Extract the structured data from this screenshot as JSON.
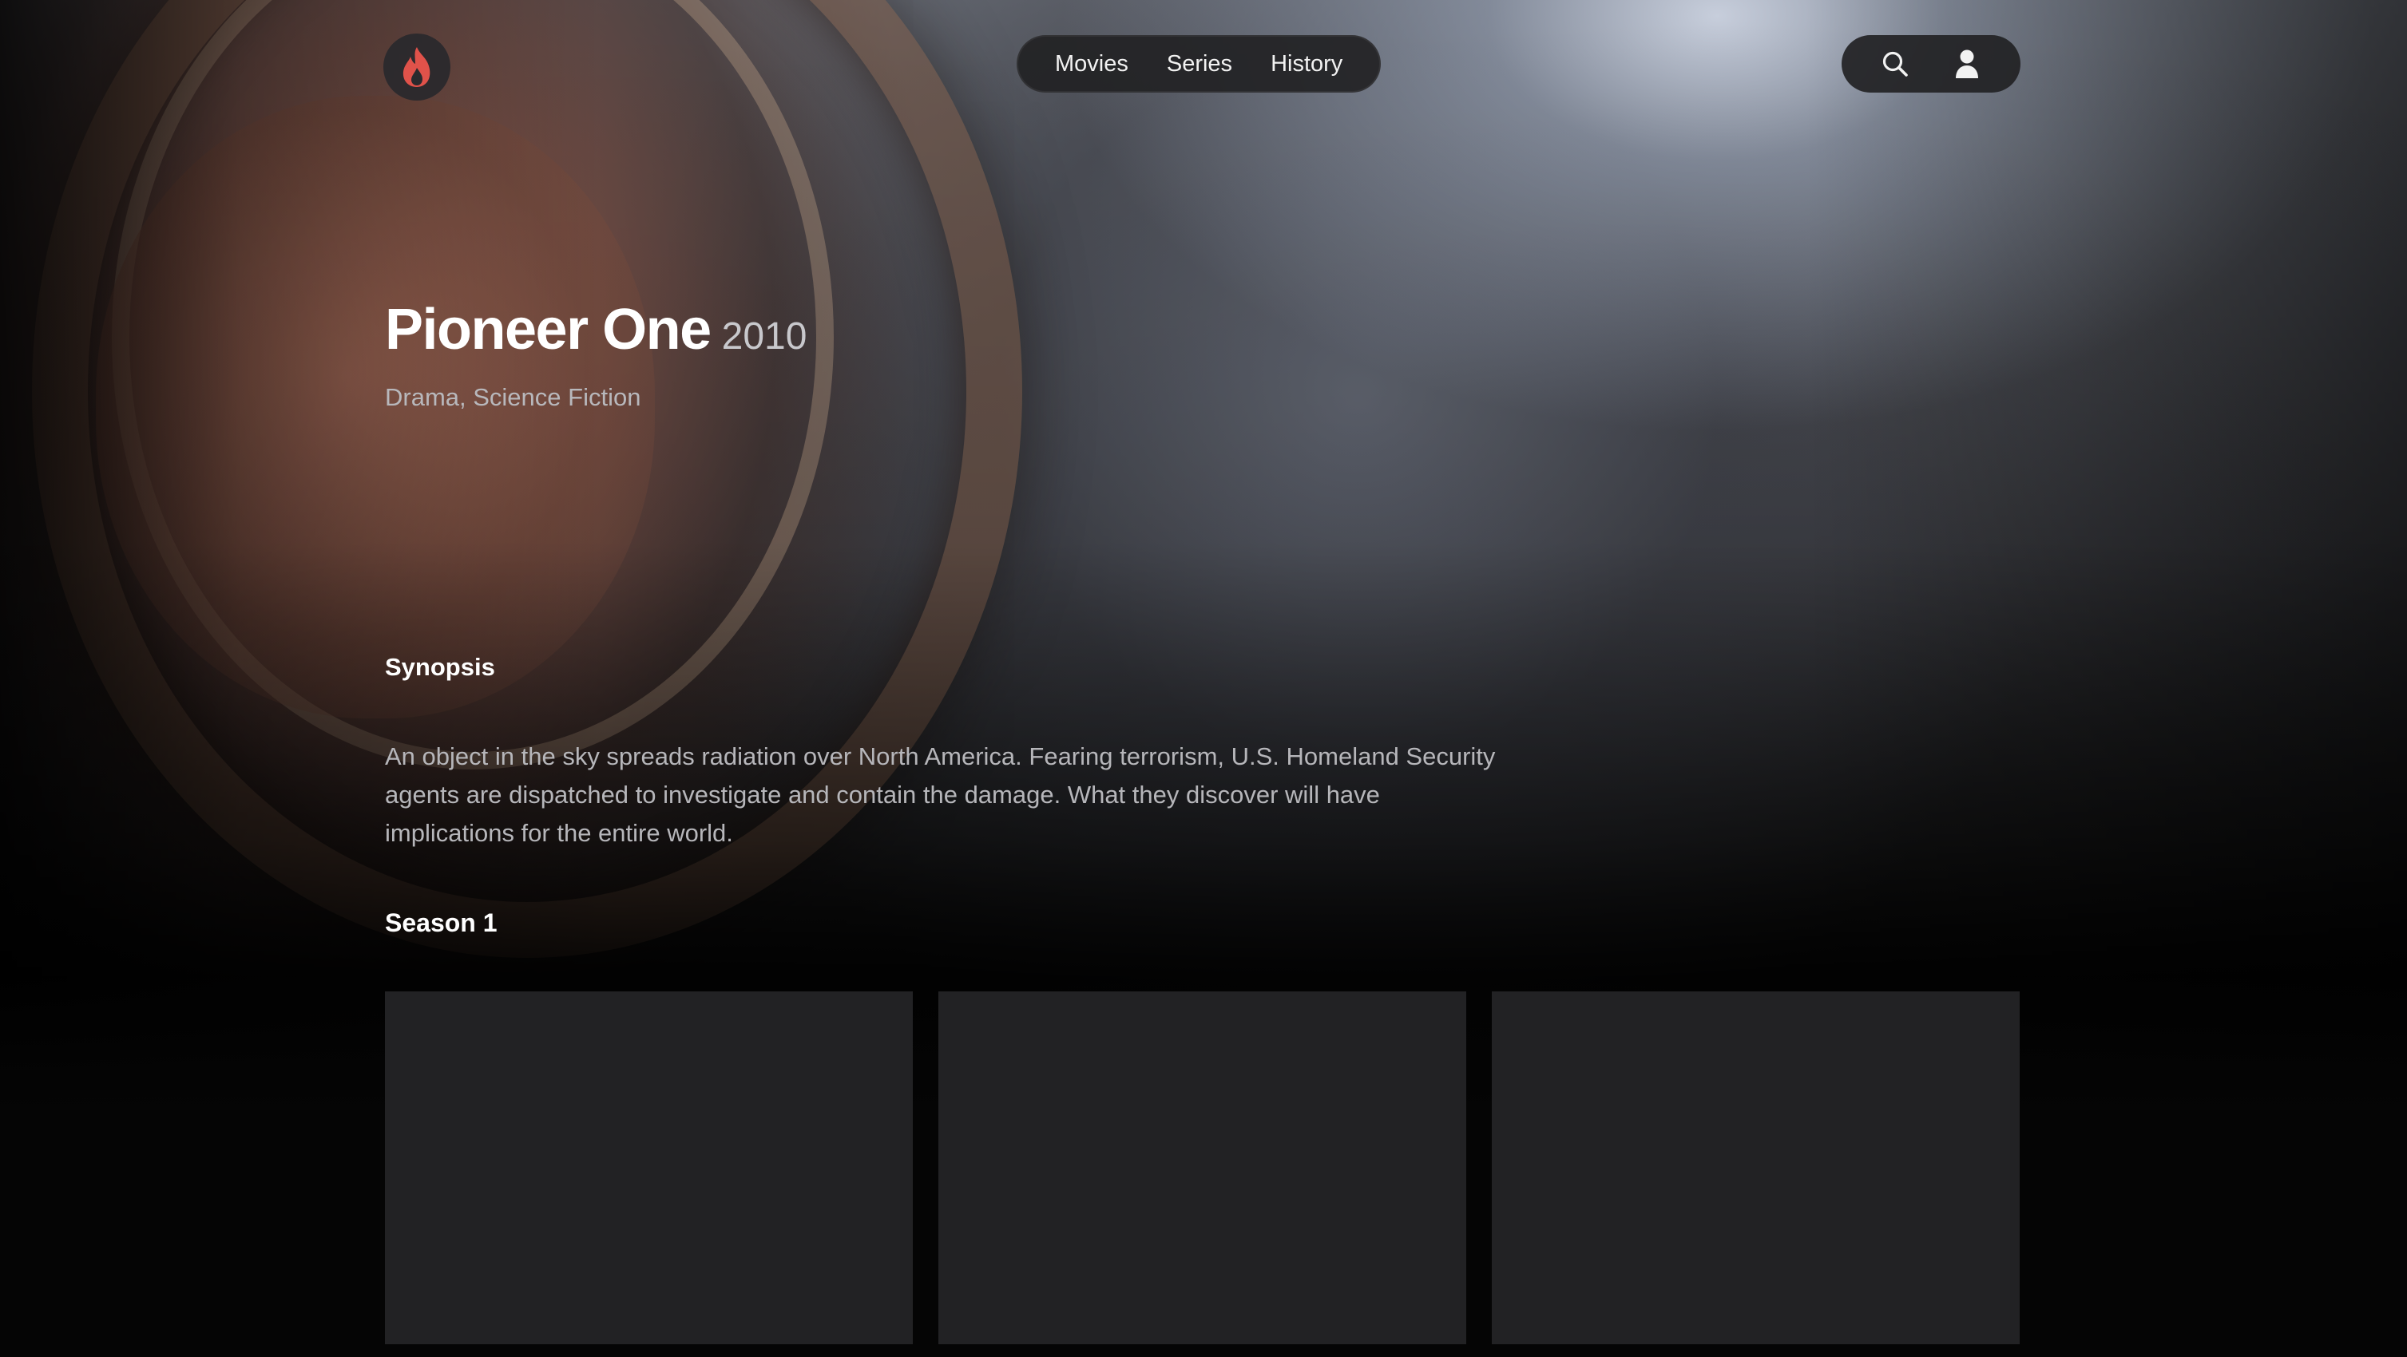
{
  "header": {
    "logo_icon": "flame-icon",
    "nav": {
      "items": [
        {
          "label": "Movies"
        },
        {
          "label": "Series"
        },
        {
          "label": "History"
        }
      ]
    },
    "actions": {
      "search_icon": "search-icon",
      "profile_icon": "user-icon"
    }
  },
  "show": {
    "title": "Pioneer One",
    "year": "2010",
    "genres": "Drama, Science Fiction"
  },
  "synopsis": {
    "heading": "Synopsis",
    "text": "An object in the sky spreads radiation over North America. Fearing terrorism, U.S. Homeland Security agents are dispatched to investigate and contain the damage. What they discover will have implications for the entire world."
  },
  "season": {
    "heading": "Season 1",
    "episodes": [
      {},
      {},
      {}
    ]
  },
  "colors": {
    "accent": "#e0524a",
    "pill_background": "#222224",
    "card_background": "#222224"
  }
}
